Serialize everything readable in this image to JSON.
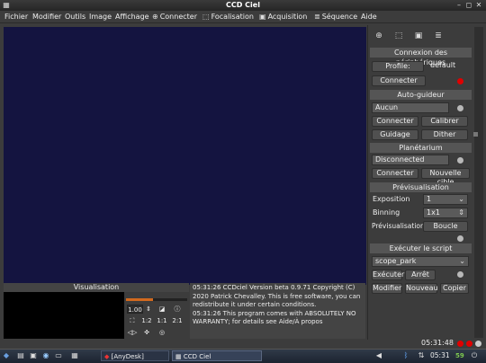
{
  "window": {
    "title": "CCD Ciel"
  },
  "menu": [
    {
      "label": "Fichier"
    },
    {
      "label": "Modifier"
    },
    {
      "label": "Outils"
    },
    {
      "label": "Image"
    },
    {
      "label": "Affichage"
    },
    {
      "label": "Connecter",
      "icon": "⊕"
    },
    {
      "label": "Focalisation",
      "icon": "⬚"
    },
    {
      "label": "Acquisition",
      "icon": "▣"
    },
    {
      "label": "Séquence",
      "icon": "≣"
    },
    {
      "label": "Aide"
    }
  ],
  "visualisation": {
    "title": "Visualisation",
    "zoom": "1.00",
    "buttons": [
      "1:2",
      "1:1",
      "2:1"
    ]
  },
  "log": {
    "lines": [
      "05:31:26 CCDciel Version beta 0.9.71 Copyright (C)",
      "2020 Patrick Chevalley. This is free software, you can",
      "redistribute it under certain conditions.",
      "05:31:26 This program comes with ABSOLUTELY NO",
      "WARRANTY; for details see Aide/À propos"
    ]
  },
  "devices": {
    "section_title": "Connexion des périphériques",
    "profile_button": "Profile:",
    "profile_value": "default",
    "connect_button": "Connecter",
    "status_color": "#e00000"
  },
  "autoguider": {
    "section_title": "Auto-guideur",
    "name": "Aucun",
    "connect_button": "Connecter",
    "calibrate_button": "Calibrer",
    "guide_button": "Guidage",
    "dither_button": "Dither"
  },
  "planetarium": {
    "section_title": "Planétarium",
    "status": "Disconnected",
    "connect_button": "Connecter",
    "new_target_button": "Nouvelle cible"
  },
  "preview": {
    "section_title": "Prévisualisation",
    "exposure_label": "Exposition",
    "exposure_value": "1",
    "binning_label": "Binning",
    "binning_value": "1x1",
    "preview_button": "Prévisualisation",
    "loop_button": "Boucle"
  },
  "script": {
    "section_title": "Exécuter le script",
    "script_name": "scope_park",
    "run_button": "Exécuter",
    "stop_button": "Arrêt",
    "edit_button": "Modifier",
    "new_button": "Nouveau",
    "copy_button": "Copier"
  },
  "status": {
    "time": "05:31:48",
    "leds": [
      "#e00000",
      "#e00000",
      "#c8c8c8"
    ]
  },
  "taskbar": {
    "tasks": [
      "[AnyDesk]",
      "CCD Ciel"
    ],
    "clock": "05:31",
    "battery": "59"
  },
  "colors": {
    "image_bg": "#141440",
    "accent": "#d2691e"
  }
}
